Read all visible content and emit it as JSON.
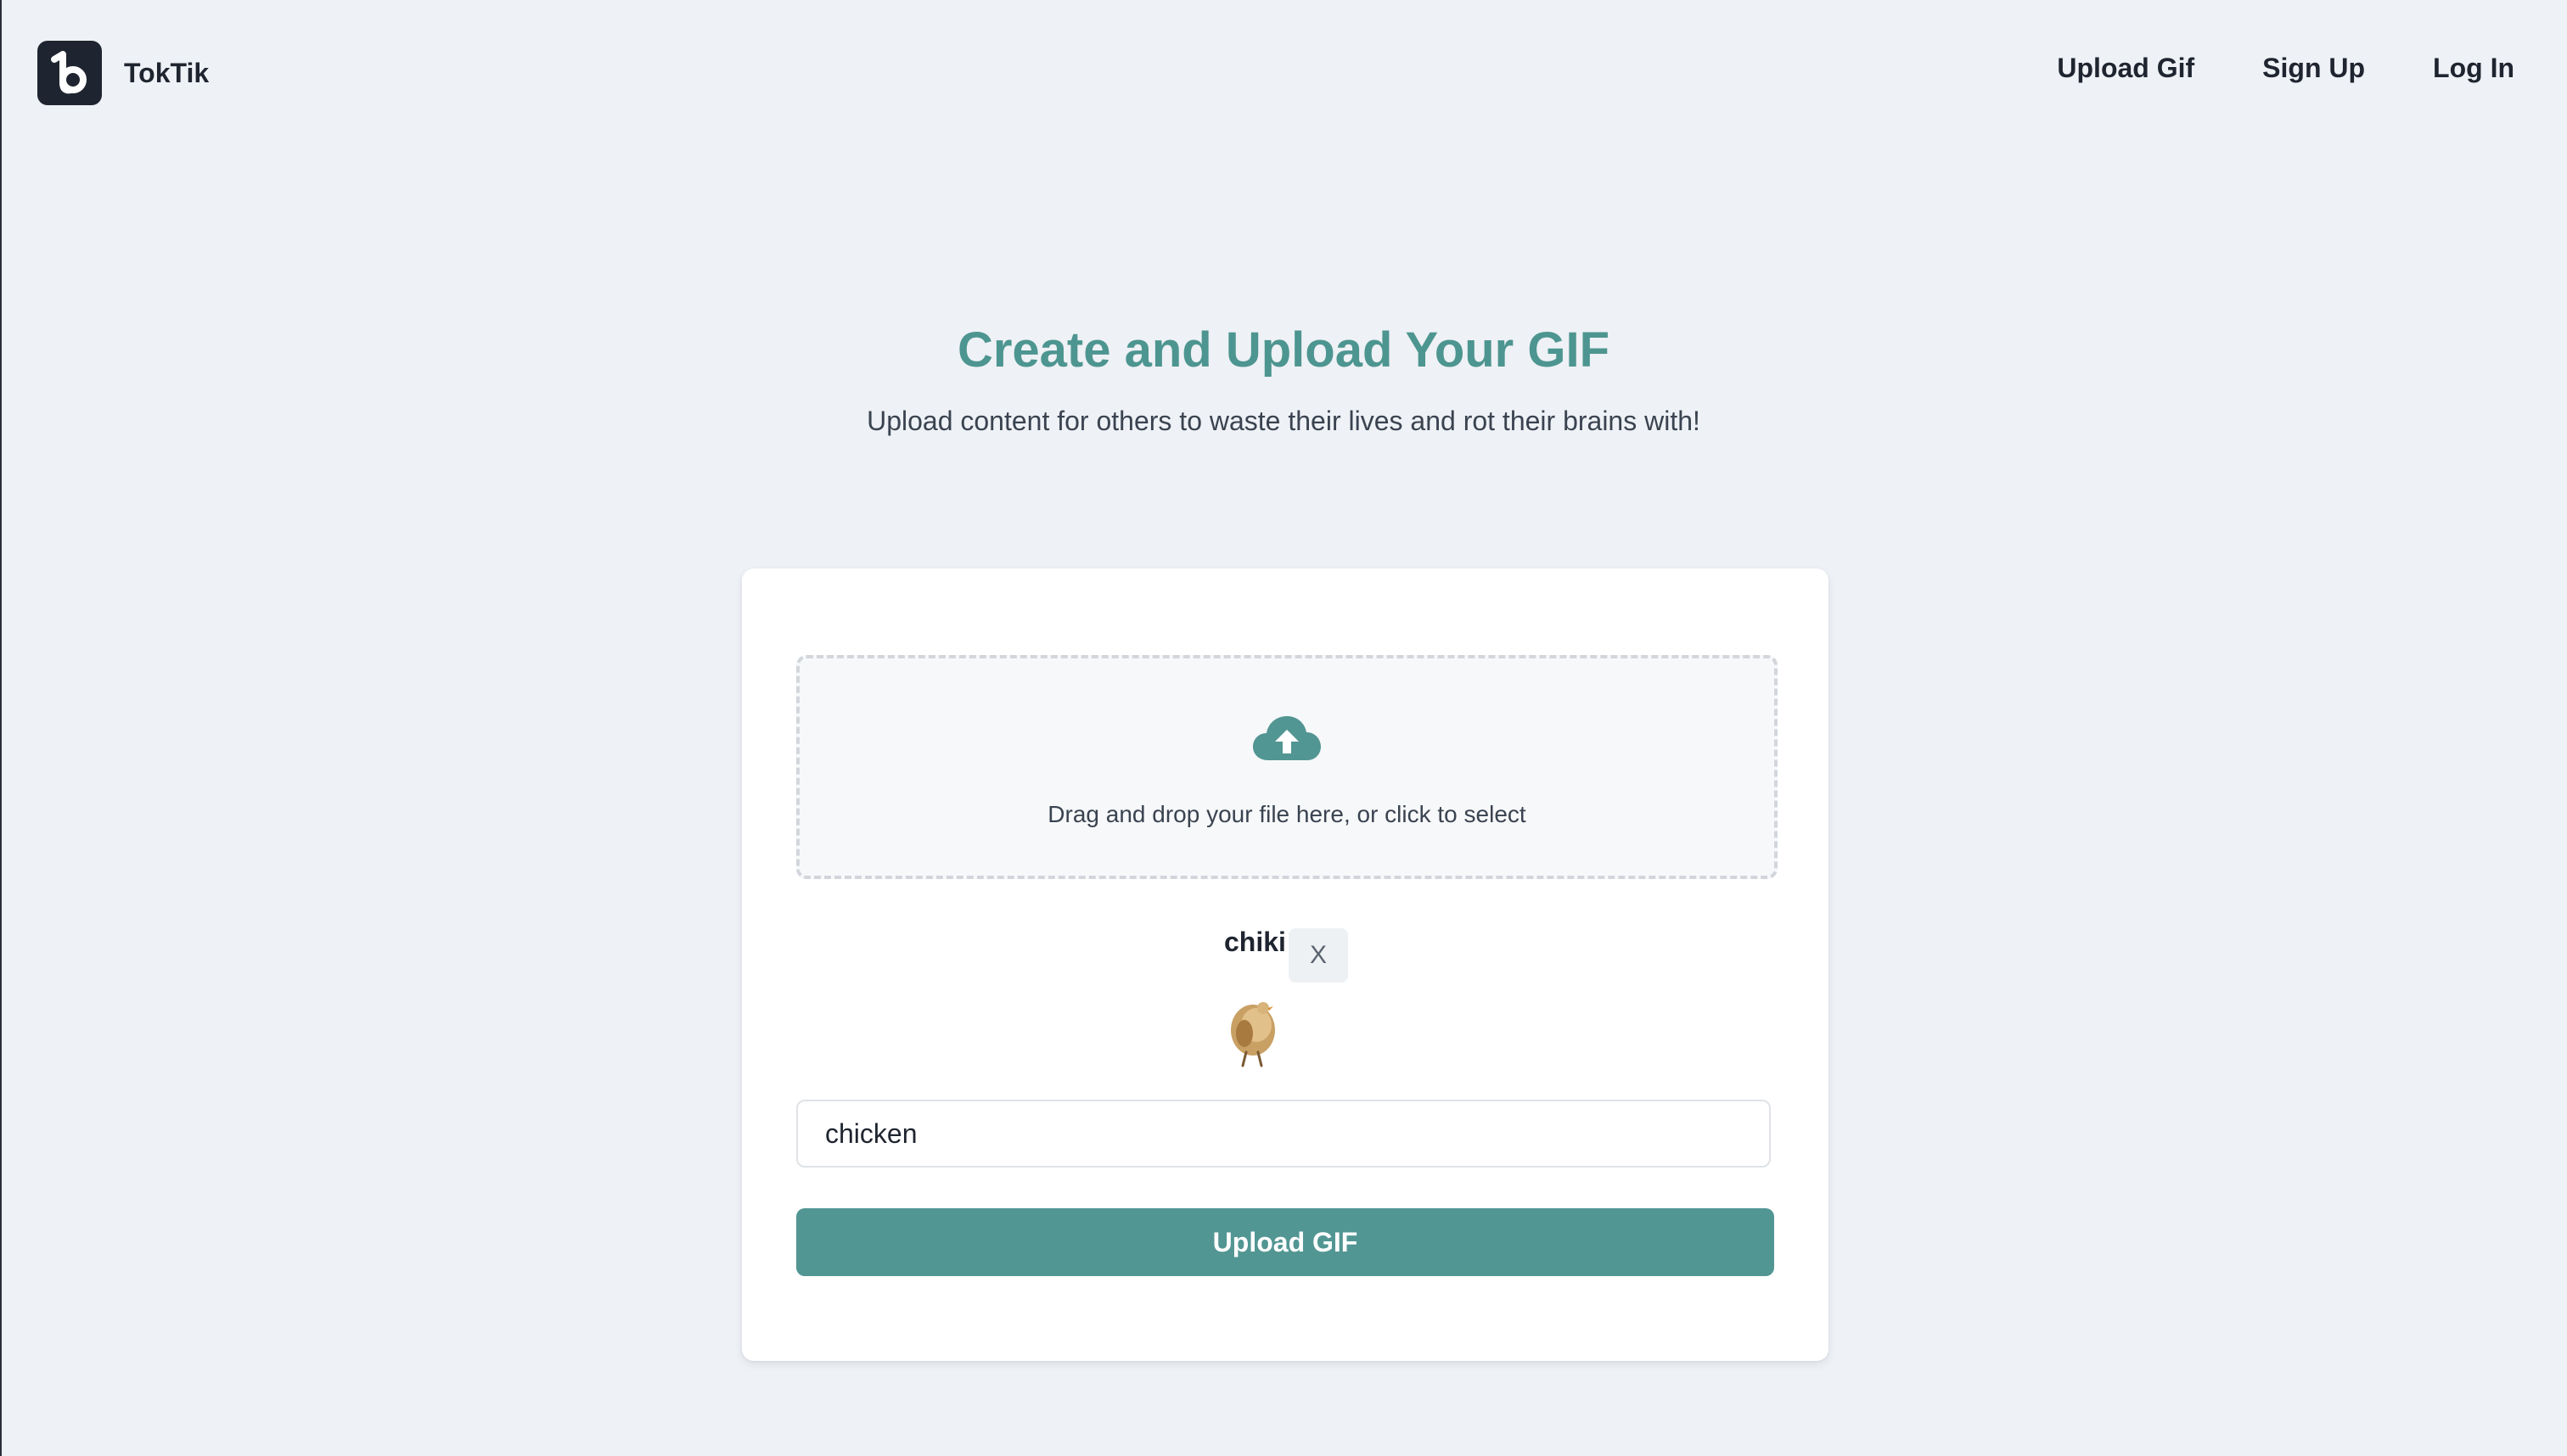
{
  "header": {
    "brand_name": "TokTik",
    "nav": [
      {
        "label": "Upload Gif"
      },
      {
        "label": "Sign Up"
      },
      {
        "label": "Log In"
      }
    ]
  },
  "hero": {
    "title": "Create and Upload Your GIF",
    "subtitle": "Upload content for others to waste their lives and rot their brains with!"
  },
  "upload": {
    "dropzone_text": "Drag and drop your file here, or click to select",
    "file_name": "chiki",
    "remove_label": "X",
    "title_value": "chicken",
    "submit_label": "Upload GIF"
  },
  "colors": {
    "accent": "#529693",
    "title": "#4d9590",
    "background": "#eef1f5",
    "logo_bg": "#1f2530"
  },
  "icons": {
    "logo": "toktik-logo-icon",
    "upload": "cloud-upload-icon",
    "thumbnail": "chicken-gif-thumbnail"
  }
}
